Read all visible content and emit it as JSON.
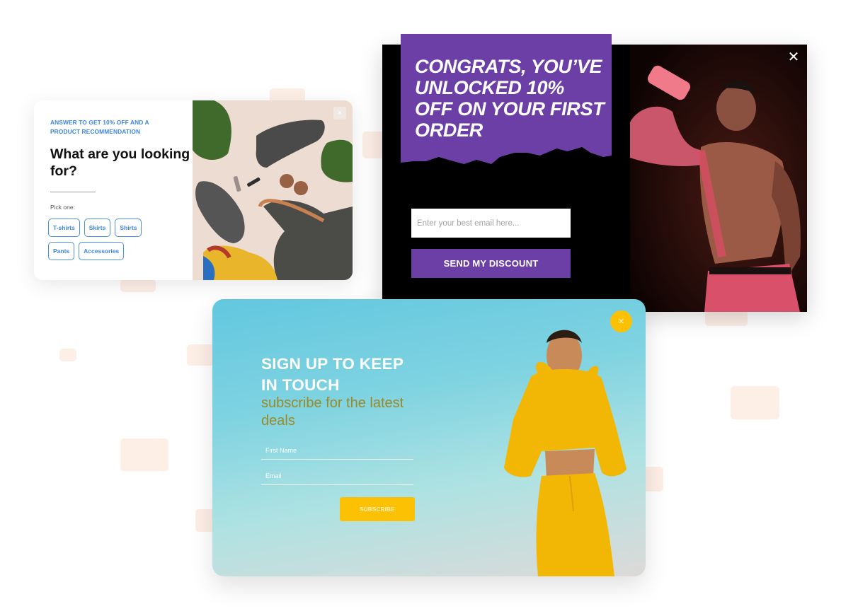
{
  "quiz_popup": {
    "eyebrow": "ANSWER TO GET 10% OFF AND A PRODUCT RECOMMENDATION",
    "title": "What are you looking for?",
    "pick_label": "Pick one:",
    "options": [
      "T-shirts",
      "Skirts",
      "Shirts",
      "Pants",
      "Accessories"
    ],
    "close_icon": "×",
    "image_alt": "Flat lay of sneakers, sunglasses, lipstick, leather bag and silk scarf",
    "accent_color": "#3d86e0"
  },
  "discount_popup": {
    "title": "CONGRATS, YOU’VE UNLOCKED 10% OFF ON YOUR FIRST ORDER",
    "email_placeholder": "Enter your best email here...",
    "email_value": "",
    "button_label": "SEND MY DISCOUNT",
    "close_icon": "✕",
    "image_alt": "Athlete drinking from a shaker bottle",
    "accent_color": "#6c3fa7"
  },
  "signup_popup": {
    "title": "SIGN UP TO KEEP IN TOUCH",
    "subtitle": "subscribe for the latest deals",
    "first_name_placeholder": "First Name",
    "email_placeholder": "Email",
    "first_name_value": "",
    "email_value": "",
    "button_label": "SUBSCRIBE",
    "close_icon": "×",
    "image_alt": "Woman in yellow hoodie and sweatpants against blue sky",
    "accent_color": "#fdc104"
  }
}
